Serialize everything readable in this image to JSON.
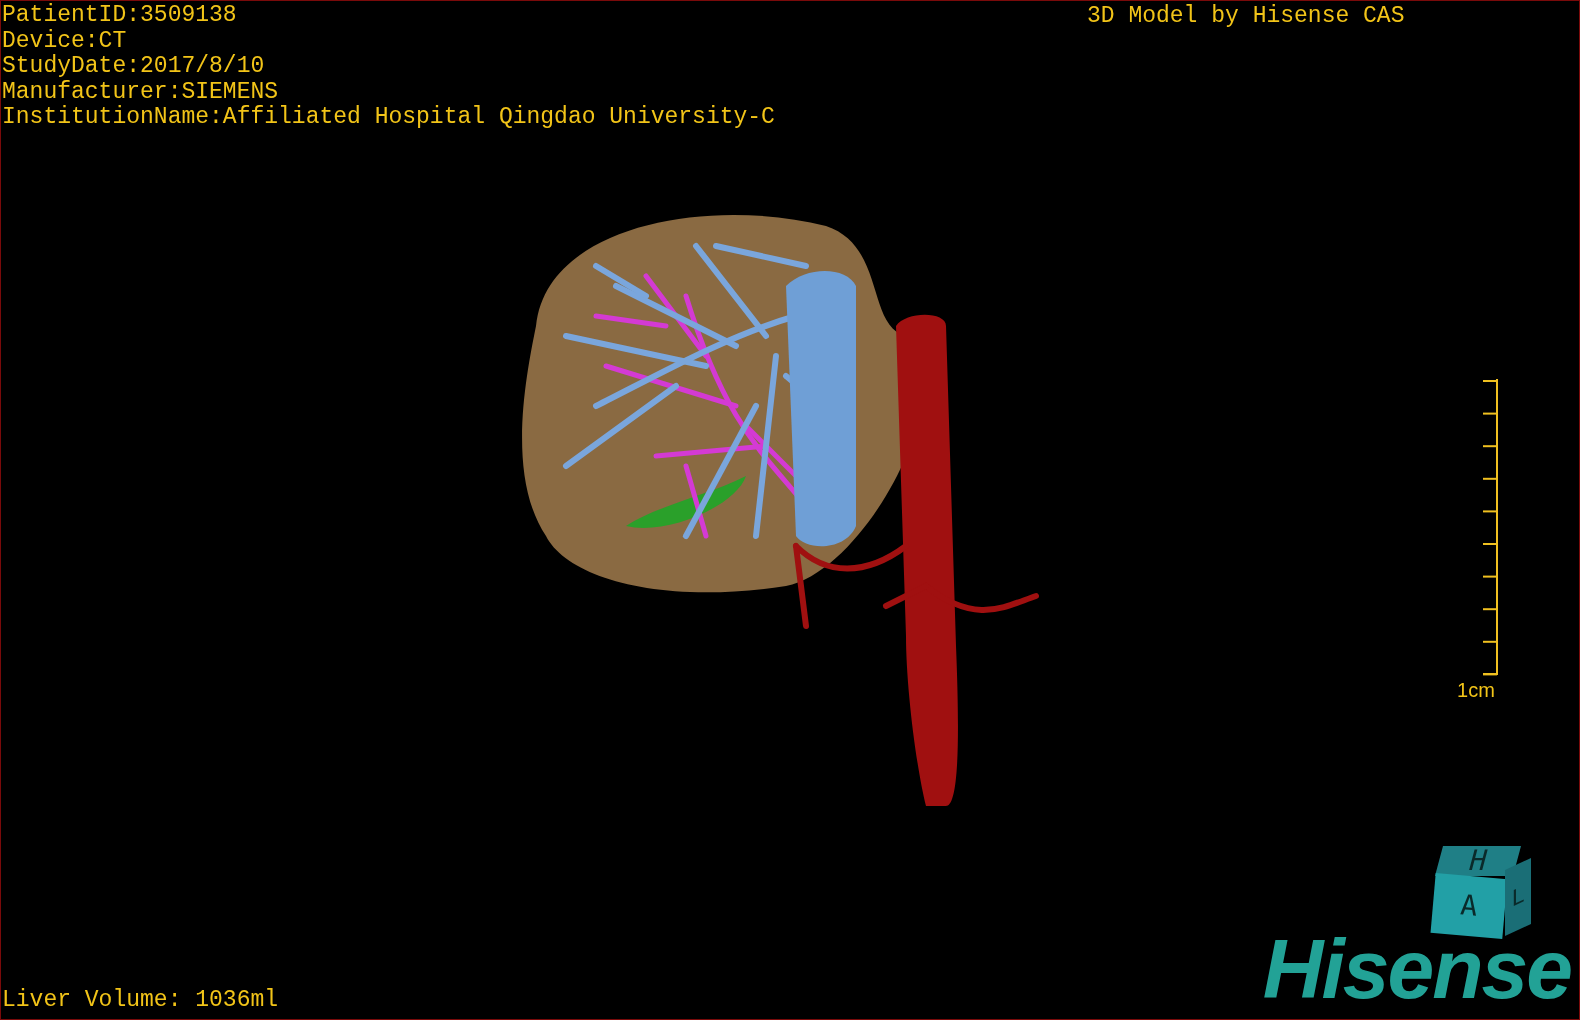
{
  "info_lines": [
    "PatientID:3509138",
    "Device:CT",
    "StudyDate:2017/8/10",
    "Manufacturer:SIEMENS",
    "InstitutionName:Affiliated Hospital Qingdao University-C"
  ],
  "title": "3D Model by Hisense CAS",
  "scale_bar": {
    "label": "1cm"
  },
  "orientation_cube": {
    "top": "H",
    "front": "A",
    "side": "L"
  },
  "liver_volume": "Liver Volume: 1036ml",
  "logo": "Hisense"
}
